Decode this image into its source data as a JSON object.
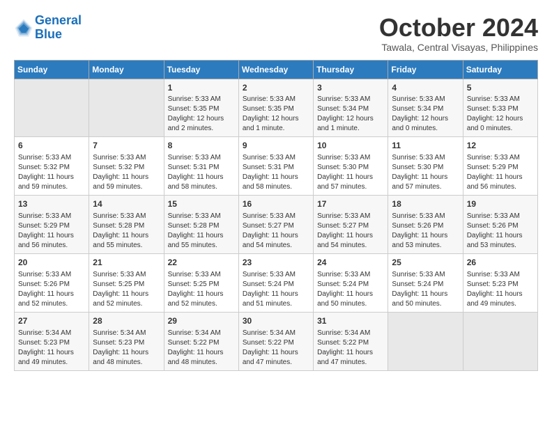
{
  "header": {
    "logo_line1": "General",
    "logo_line2": "Blue",
    "month_title": "October 2024",
    "location": "Tawala, Central Visayas, Philippines"
  },
  "days_of_week": [
    "Sunday",
    "Monday",
    "Tuesday",
    "Wednesday",
    "Thursday",
    "Friday",
    "Saturday"
  ],
  "weeks": [
    [
      {
        "day": "",
        "info": ""
      },
      {
        "day": "",
        "info": ""
      },
      {
        "day": "1",
        "info": "Sunrise: 5:33 AM\nSunset: 5:35 PM\nDaylight: 12 hours\nand 2 minutes."
      },
      {
        "day": "2",
        "info": "Sunrise: 5:33 AM\nSunset: 5:35 PM\nDaylight: 12 hours\nand 1 minute."
      },
      {
        "day": "3",
        "info": "Sunrise: 5:33 AM\nSunset: 5:34 PM\nDaylight: 12 hours\nand 1 minute."
      },
      {
        "day": "4",
        "info": "Sunrise: 5:33 AM\nSunset: 5:34 PM\nDaylight: 12 hours\nand 0 minutes."
      },
      {
        "day": "5",
        "info": "Sunrise: 5:33 AM\nSunset: 5:33 PM\nDaylight: 12 hours\nand 0 minutes."
      }
    ],
    [
      {
        "day": "6",
        "info": "Sunrise: 5:33 AM\nSunset: 5:32 PM\nDaylight: 11 hours\nand 59 minutes."
      },
      {
        "day": "7",
        "info": "Sunrise: 5:33 AM\nSunset: 5:32 PM\nDaylight: 11 hours\nand 59 minutes."
      },
      {
        "day": "8",
        "info": "Sunrise: 5:33 AM\nSunset: 5:31 PM\nDaylight: 11 hours\nand 58 minutes."
      },
      {
        "day": "9",
        "info": "Sunrise: 5:33 AM\nSunset: 5:31 PM\nDaylight: 11 hours\nand 58 minutes."
      },
      {
        "day": "10",
        "info": "Sunrise: 5:33 AM\nSunset: 5:30 PM\nDaylight: 11 hours\nand 57 minutes."
      },
      {
        "day": "11",
        "info": "Sunrise: 5:33 AM\nSunset: 5:30 PM\nDaylight: 11 hours\nand 57 minutes."
      },
      {
        "day": "12",
        "info": "Sunrise: 5:33 AM\nSunset: 5:29 PM\nDaylight: 11 hours\nand 56 minutes."
      }
    ],
    [
      {
        "day": "13",
        "info": "Sunrise: 5:33 AM\nSunset: 5:29 PM\nDaylight: 11 hours\nand 56 minutes."
      },
      {
        "day": "14",
        "info": "Sunrise: 5:33 AM\nSunset: 5:28 PM\nDaylight: 11 hours\nand 55 minutes."
      },
      {
        "day": "15",
        "info": "Sunrise: 5:33 AM\nSunset: 5:28 PM\nDaylight: 11 hours\nand 55 minutes."
      },
      {
        "day": "16",
        "info": "Sunrise: 5:33 AM\nSunset: 5:27 PM\nDaylight: 11 hours\nand 54 minutes."
      },
      {
        "day": "17",
        "info": "Sunrise: 5:33 AM\nSunset: 5:27 PM\nDaylight: 11 hours\nand 54 minutes."
      },
      {
        "day": "18",
        "info": "Sunrise: 5:33 AM\nSunset: 5:26 PM\nDaylight: 11 hours\nand 53 minutes."
      },
      {
        "day": "19",
        "info": "Sunrise: 5:33 AM\nSunset: 5:26 PM\nDaylight: 11 hours\nand 53 minutes."
      }
    ],
    [
      {
        "day": "20",
        "info": "Sunrise: 5:33 AM\nSunset: 5:26 PM\nDaylight: 11 hours\nand 52 minutes."
      },
      {
        "day": "21",
        "info": "Sunrise: 5:33 AM\nSunset: 5:25 PM\nDaylight: 11 hours\nand 52 minutes."
      },
      {
        "day": "22",
        "info": "Sunrise: 5:33 AM\nSunset: 5:25 PM\nDaylight: 11 hours\nand 52 minutes."
      },
      {
        "day": "23",
        "info": "Sunrise: 5:33 AM\nSunset: 5:24 PM\nDaylight: 11 hours\nand 51 minutes."
      },
      {
        "day": "24",
        "info": "Sunrise: 5:33 AM\nSunset: 5:24 PM\nDaylight: 11 hours\nand 50 minutes."
      },
      {
        "day": "25",
        "info": "Sunrise: 5:33 AM\nSunset: 5:24 PM\nDaylight: 11 hours\nand 50 minutes."
      },
      {
        "day": "26",
        "info": "Sunrise: 5:33 AM\nSunset: 5:23 PM\nDaylight: 11 hours\nand 49 minutes."
      }
    ],
    [
      {
        "day": "27",
        "info": "Sunrise: 5:34 AM\nSunset: 5:23 PM\nDaylight: 11 hours\nand 49 minutes."
      },
      {
        "day": "28",
        "info": "Sunrise: 5:34 AM\nSunset: 5:23 PM\nDaylight: 11 hours\nand 48 minutes."
      },
      {
        "day": "29",
        "info": "Sunrise: 5:34 AM\nSunset: 5:22 PM\nDaylight: 11 hours\nand 48 minutes."
      },
      {
        "day": "30",
        "info": "Sunrise: 5:34 AM\nSunset: 5:22 PM\nDaylight: 11 hours\nand 47 minutes."
      },
      {
        "day": "31",
        "info": "Sunrise: 5:34 AM\nSunset: 5:22 PM\nDaylight: 11 hours\nand 47 minutes."
      },
      {
        "day": "",
        "info": ""
      },
      {
        "day": "",
        "info": ""
      }
    ]
  ]
}
